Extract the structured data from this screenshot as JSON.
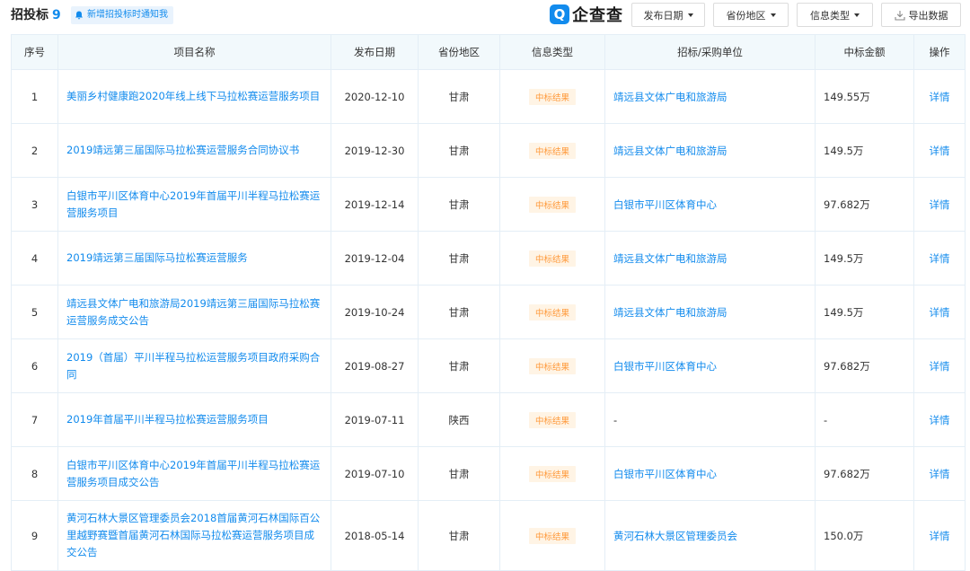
{
  "header": {
    "title": "招投标",
    "count": "9",
    "notify_label": "新增招投标时通知我",
    "logo_mark": "Q",
    "logo_text": "企查查",
    "filters": [
      {
        "label": "发布日期"
      },
      {
        "label": "省份地区"
      },
      {
        "label": "信息类型"
      }
    ],
    "export_label": "导出数据"
  },
  "columns": [
    "序号",
    "项目名称",
    "发布日期",
    "省份地区",
    "信息类型",
    "招标/采购单位",
    "中标金额",
    "操作"
  ],
  "rows": [
    {
      "no": "1",
      "name": "美丽乡村健康跑2020年线上线下马拉松赛运营服务项目",
      "date": "2020-12-10",
      "region": "甘肃",
      "type": "中标结果",
      "unit": "靖远县文体广电和旅游局",
      "amount": "149.55万",
      "action": "详情"
    },
    {
      "no": "2",
      "name": "2019靖远第三届国际马拉松赛运营服务合同协议书",
      "date": "2019-12-30",
      "region": "甘肃",
      "type": "中标结果",
      "unit": "靖远县文体广电和旅游局",
      "amount": "149.5万",
      "action": "详情"
    },
    {
      "no": "3",
      "name": "白银市平川区体育中心2019年首届平川半程马拉松赛运营服务项目",
      "date": "2019-12-14",
      "region": "甘肃",
      "type": "中标结果",
      "unit": "白银市平川区体育中心",
      "amount": "97.682万",
      "action": "详情"
    },
    {
      "no": "4",
      "name": "2019靖远第三届国际马拉松赛运营服务",
      "date": "2019-12-04",
      "region": "甘肃",
      "type": "中标结果",
      "unit": "靖远县文体广电和旅游局",
      "amount": "149.5万",
      "action": "详情"
    },
    {
      "no": "5",
      "name": "靖远县文体广电和旅游局2019靖远第三届国际马拉松赛运营服务成交公告",
      "date": "2019-10-24",
      "region": "甘肃",
      "type": "中标结果",
      "unit": "靖远县文体广电和旅游局",
      "amount": "149.5万",
      "action": "详情"
    },
    {
      "no": "6",
      "name": "2019（首届）平川半程马拉松运营服务项目政府采购合同",
      "date": "2019-08-27",
      "region": "甘肃",
      "type": "中标结果",
      "unit": "白银市平川区体育中心",
      "amount": "97.682万",
      "action": "详情"
    },
    {
      "no": "7",
      "name": "2019年首届平川半程马拉松赛运营服务项目",
      "date": "2019-07-11",
      "region": "陕西",
      "type": "中标结果",
      "unit": "-",
      "amount": "-",
      "action": "详情"
    },
    {
      "no": "8",
      "name": "白银市平川区体育中心2019年首届平川半程马拉松赛运营服务项目成交公告",
      "date": "2019-07-10",
      "region": "甘肃",
      "type": "中标结果",
      "unit": "白银市平川区体育中心",
      "amount": "97.682万",
      "action": "详情"
    },
    {
      "no": "9",
      "name": "黄河石林大景区管理委员会2018首届黄河石林国际百公里越野赛暨首届黄河石林国际马拉松赛运营服务项目成交公告",
      "date": "2018-05-14",
      "region": "甘肃",
      "type": "中标结果",
      "unit": "黄河石林大景区管理委员会",
      "amount": "150.0万",
      "action": "详情"
    }
  ],
  "colors": {
    "accent": "#128bed",
    "tag_text": "#ff9a3c",
    "tag_bg": "#fff4e5",
    "header_bg": "#f2f9fc",
    "border": "#e4eef6"
  },
  "icons": {
    "notify": "bell-icon",
    "export": "download-icon",
    "dropdown": "caret-down-icon"
  }
}
